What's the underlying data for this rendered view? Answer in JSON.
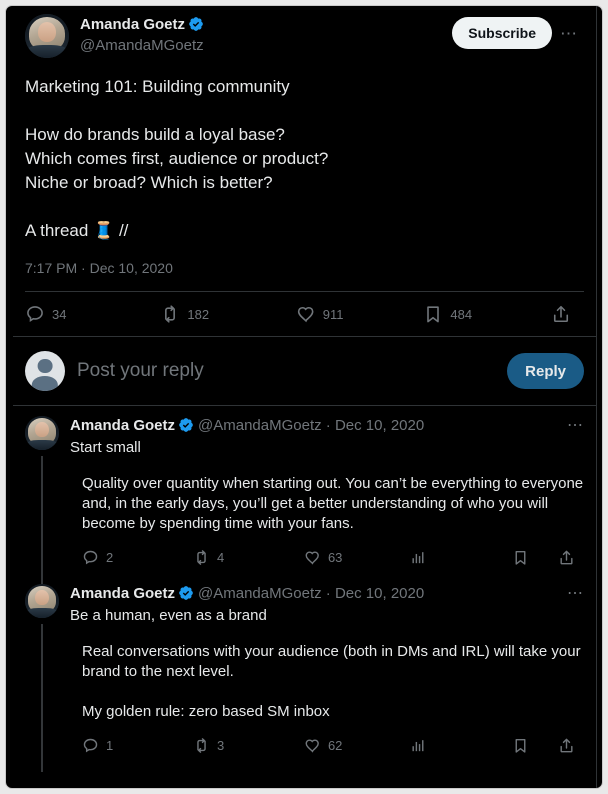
{
  "theme": {
    "background": "#000000",
    "text_primary": "#e7e9ea",
    "text_secondary": "#71767b",
    "border": "#2f3336",
    "verified_blue": "#1d9bf0",
    "reply_button_bg": "#1a5b86",
    "subscribe_button_bg": "#eff3f4"
  },
  "main_tweet": {
    "author": {
      "display_name": "Amanda Goetz",
      "handle": "@AmandaMGoetz",
      "verified": true,
      "avatar_alt": "avatar-amanda-goetz"
    },
    "subscribe_label": "Subscribe",
    "more_label": "⋯",
    "body": "Marketing 101: Building community\n\nHow do brands build a loyal base?\nWhich comes first, audience or product?\nNiche or broad? Which is better?\n\nA thread 🧵 //",
    "timestamp": "7:17 PM · Dec 10, 2020",
    "metrics": [
      {
        "icon": "reply-icon",
        "count": "34"
      },
      {
        "icon": "retweet-icon",
        "count": "182"
      },
      {
        "icon": "like-icon",
        "count": "911"
      },
      {
        "icon": "bookmark-icon",
        "count": "484"
      },
      {
        "icon": "share-icon",
        "count": ""
      }
    ]
  },
  "composer": {
    "placeholder": "Post your reply",
    "reply_label": "Reply",
    "avatar_alt": "default-avatar"
  },
  "replies": [
    {
      "author": {
        "display_name": "Amanda Goetz",
        "handle": "@AmandaMGoetz",
        "verified": true
      },
      "meta": "@AmandaMGoetz · Dec 10, 2020",
      "date": "Dec 10, 2020",
      "more_label": "⋯",
      "headline": "Start small",
      "body": "Quality over quantity when starting out. You can’t be everything to everyone and, in the early days, you’ll get a better understanding of who you will become by spending time with your fans.",
      "metrics": [
        {
          "icon": "reply-icon",
          "count": "2"
        },
        {
          "icon": "retweet-icon",
          "count": "4"
        },
        {
          "icon": "like-icon",
          "count": "63"
        },
        {
          "icon": "analytics-icon",
          "count": ""
        },
        {
          "icon": "bookmark-icon",
          "count": ""
        },
        {
          "icon": "share-icon",
          "count": ""
        }
      ]
    },
    {
      "author": {
        "display_name": "Amanda Goetz",
        "handle": "@AmandaMGoetz",
        "verified": true
      },
      "meta": "@AmandaMGoetz · Dec 10, 2020",
      "date": "Dec 10, 2020",
      "more_label": "⋯",
      "headline": "Be a human, even as a brand",
      "body": "Real conversations with your audience (both in DMs and IRL) will take your brand to the next level.\n\nMy golden rule: zero based SM inbox",
      "metrics": [
        {
          "icon": "reply-icon",
          "count": "1"
        },
        {
          "icon": "retweet-icon",
          "count": "3"
        },
        {
          "icon": "like-icon",
          "count": "62"
        },
        {
          "icon": "analytics-icon",
          "count": ""
        },
        {
          "icon": "bookmark-icon",
          "count": ""
        },
        {
          "icon": "share-icon",
          "count": ""
        }
      ]
    }
  ]
}
